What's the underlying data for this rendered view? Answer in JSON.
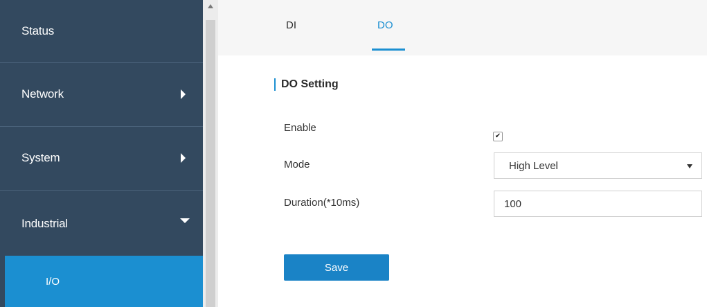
{
  "sidebar": {
    "items": [
      {
        "label": "Status"
      },
      {
        "label": "Network"
      },
      {
        "label": "System"
      },
      {
        "label": "Industrial"
      }
    ],
    "sub_items": [
      {
        "label": "I/O"
      }
    ]
  },
  "tabs": [
    {
      "label": "DI"
    },
    {
      "label": "DO"
    }
  ],
  "section": {
    "title": "DO Setting"
  },
  "form": {
    "enable_label": "Enable",
    "enable_checked": true,
    "mode_label": "Mode",
    "mode_value": "High Level",
    "duration_label": "Duration(*10ms)",
    "duration_value": "100"
  },
  "actions": {
    "save_label": "Save"
  },
  "colors": {
    "sidebar_bg": "#33495f",
    "accent": "#1b8fd1"
  }
}
